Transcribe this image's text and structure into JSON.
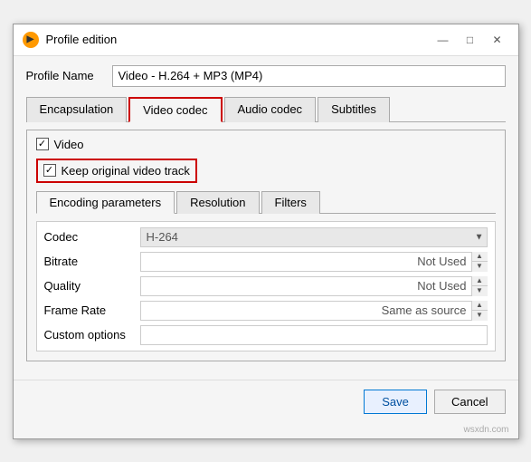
{
  "window": {
    "title": "Profile edition",
    "icon": "🔶"
  },
  "titleButtons": {
    "minimize": "—",
    "maximize": "□",
    "close": "✕"
  },
  "profileName": {
    "label": "Profile Name",
    "value": "Video - H.264 + MP3 (MP4)"
  },
  "tabs": [
    {
      "id": "encapsulation",
      "label": "Encapsulation",
      "active": false
    },
    {
      "id": "video-codec",
      "label": "Video codec",
      "active": true
    },
    {
      "id": "audio-codec",
      "label": "Audio codec",
      "active": false
    },
    {
      "id": "subtitles",
      "label": "Subtitles",
      "active": false
    }
  ],
  "videoSection": {
    "label": "Video",
    "checked": true
  },
  "keepOriginal": {
    "label": "Keep original video track",
    "checked": true
  },
  "innerTabs": [
    {
      "id": "encoding-params",
      "label": "Encoding parameters",
      "active": true
    },
    {
      "id": "resolution",
      "label": "Resolution",
      "active": false
    },
    {
      "id": "filters",
      "label": "Filters",
      "active": false
    }
  ],
  "params": [
    {
      "id": "codec",
      "label": "Codec",
      "type": "select",
      "value": "H-264",
      "placeholder": ""
    },
    {
      "id": "bitrate",
      "label": "Bitrate",
      "type": "spin",
      "value": "Not Used"
    },
    {
      "id": "quality",
      "label": "Quality",
      "type": "spin",
      "value": "Not Used"
    },
    {
      "id": "framerate",
      "label": "Frame Rate",
      "type": "spin",
      "value": "Same as source"
    },
    {
      "id": "custom",
      "label": "Custom options",
      "type": "text",
      "value": ""
    }
  ],
  "footer": {
    "save": "Save",
    "cancel": "Cancel"
  },
  "watermark": "wsxdn.com"
}
